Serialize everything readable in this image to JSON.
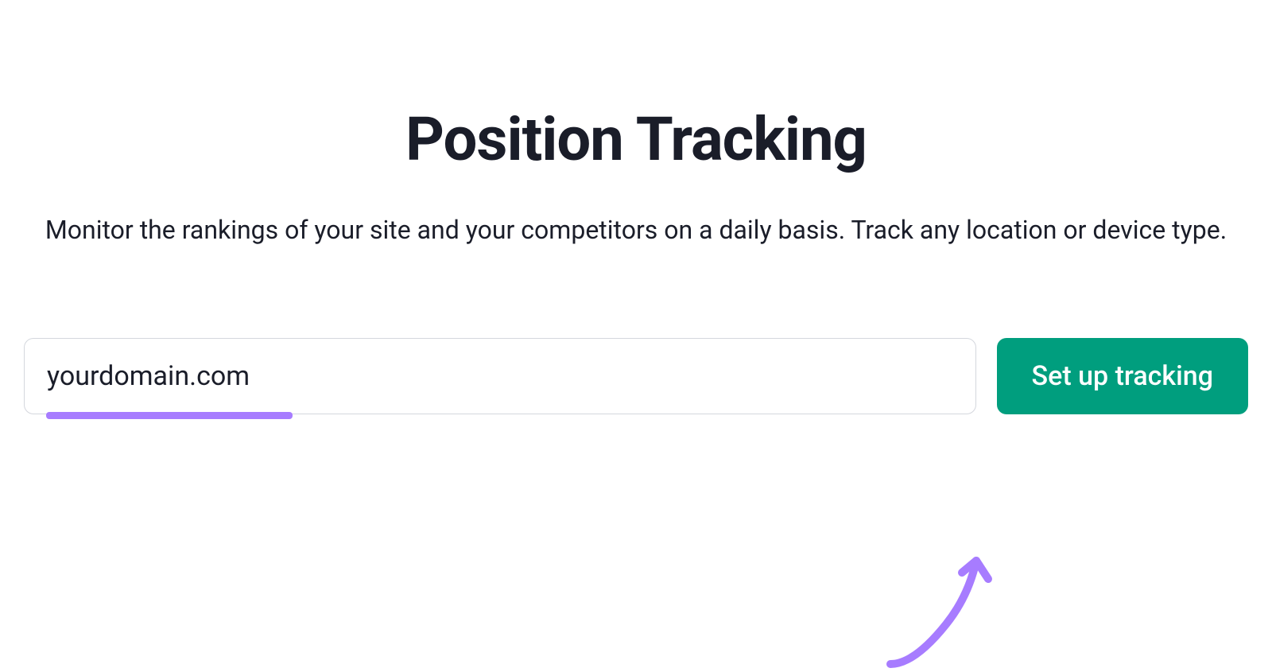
{
  "header": {
    "title": "Position Tracking",
    "subtitle": "Monitor the rankings of your site and your competitors on a daily basis. Track any location or device type."
  },
  "form": {
    "domain_value": "yourdomain.com",
    "submit_label": "Set up tracking"
  },
  "colors": {
    "accent_green": "#009e7e",
    "annotation_purple": "#a77cff",
    "text_dark": "#1a1d29",
    "border_gray": "#d4d7dd"
  }
}
